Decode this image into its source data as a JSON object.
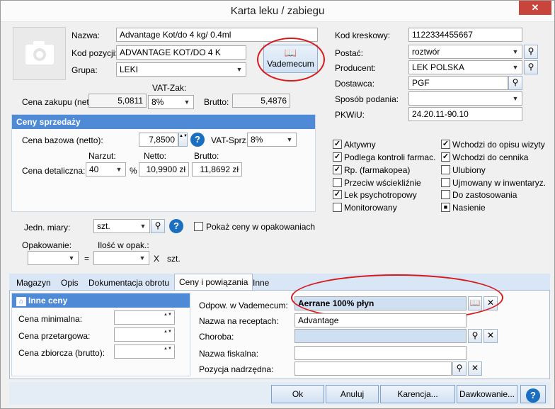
{
  "window": {
    "title": "Karta leku / zabiegu",
    "close": "✕"
  },
  "left": {
    "nazwa_label": "Nazwa:",
    "nazwa_value": "Advantage Kot/do 4 kg/ 0.4ml",
    "kod_label": "Kod pozycji:",
    "kod_value": "ADVANTAGE KOT/DO 4 K",
    "grupa_label": "Grupa:",
    "grupa_value": "LEKI",
    "vademecum_label": "Vademecum",
    "vat_zak_label": "VAT-Zak:",
    "cena_zakupu_label": "Cena zakupu (net):",
    "cena_zakupu_value": "5,0811",
    "vat_zak_value": "8%",
    "brutto_label": "Brutto:",
    "brutto_value": "5,4876"
  },
  "ceny": {
    "header": "Ceny sprzedaży",
    "bazowa_label": "Cena bazowa (netto):",
    "bazowa_value": "7,8500",
    "vat_sprz_label": "VAT-Sprz.:",
    "vat_sprz_value": "8%",
    "narzut_label": "Narzut:",
    "netto_label": "Netto:",
    "brutto_label": "Brutto:",
    "detaliczna_label": "Cena detaliczna:",
    "narzut_value": "40",
    "percent": "%",
    "netto_value": "10,9900 zł",
    "brutto_value": "11,8692 zł"
  },
  "jedn": {
    "label": "Jedn. miary:",
    "value": "szt.",
    "pokaz_label": "Pokaż ceny w opakowaniach",
    "opak_label": "Opakowanie:",
    "ilosc_label": "Ilość w opak.:",
    "eq": "=",
    "x": "X",
    "szt": "szt."
  },
  "right": {
    "kod_label": "Kod kreskowy:",
    "kod_value": "1122334455667",
    "postac_label": "Postać:",
    "postac_value": "roztwór",
    "producent_label": "Producent:",
    "producent_value": "LEK POLSKA",
    "dostawca_label": "Dostawca:",
    "dostawca_value": "PGF",
    "sposob_label": "Sposób podania:",
    "sposob_value": "",
    "pkwiu_label": "PKWiU:",
    "pkwiu_value": "24.20.11-90.10"
  },
  "checks": [
    {
      "label": "Aktywny",
      "checked": true
    },
    {
      "label": "Podlega kontroli farmac.",
      "checked": true
    },
    {
      "label": "Rp. (farmakopea)",
      "checked": true
    },
    {
      "label": "Przeciw wściekliźnie",
      "checked": false
    },
    {
      "label": "Lek psychotropowy",
      "checked": true
    },
    {
      "label": "Monitorowany",
      "checked": false
    },
    {
      "label": "Wchodzi do opisu wizyty",
      "checked": true
    },
    {
      "label": "Wchodzi do cennika",
      "checked": true
    },
    {
      "label": "Ulubiony",
      "checked": false
    },
    {
      "label": "Ujmowany w inwentaryz.",
      "checked": false
    },
    {
      "label": "Do zastosowania",
      "checked": false
    },
    {
      "label": "Nasienie",
      "checked": "indeterminate"
    }
  ],
  "tabs": [
    "Magazyn",
    "Opis",
    "Dokumentacja obrotu",
    "Ceny i powiązania",
    "Inne"
  ],
  "inne_ceny": {
    "header": "Inne ceny",
    "min_label": "Cena minimalna:",
    "przet_label": "Cena przetargowa:",
    "zb_label": "Cena zbiorcza (brutto):"
  },
  "powiazania": {
    "vademecum_label": "Odpow. w Vademecum:",
    "vademecum_value": "Aerrane 100% płyn",
    "recepta_label": "Nazwa na receptach:",
    "recepta_value": "Advantage",
    "choroba_label": "Choroba:",
    "choroba_value": "",
    "fiskalna_label": "Nazwa fiskalna:",
    "fiskalna_value": "",
    "nadrzedna_label": "Pozycja nadrzędna:",
    "nadrzedna_value": ""
  },
  "footer": {
    "ok": "Ok",
    "anuluj": "Anuluj",
    "karencja": "Karencja...",
    "dawkowanie": "Dawkowanie...",
    "help": "?"
  },
  "glyphs": {
    "search": "⚲",
    "book": "📖",
    "clear": "✕",
    "down": "▼",
    "help": "?",
    "spin": "▲▼",
    "check": "✓",
    "square": "■"
  },
  "accent_color": "#4f8ad6",
  "annotation_color": "#d8191c"
}
